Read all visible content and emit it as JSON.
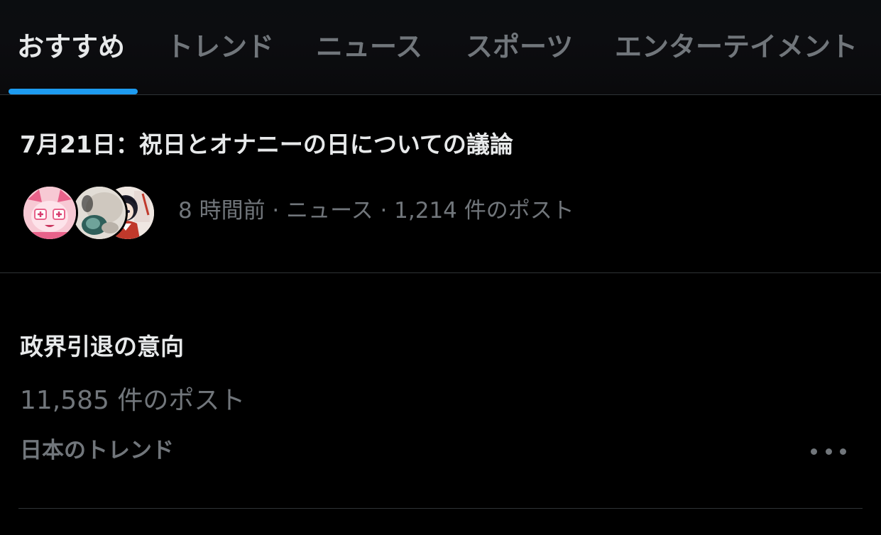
{
  "tabs": [
    {
      "label": "おすすめ",
      "active": true
    },
    {
      "label": "トレンド",
      "active": false
    },
    {
      "label": "ニュース",
      "active": false
    },
    {
      "label": "スポーツ",
      "active": false
    },
    {
      "label": "エンターテイメント",
      "active": false
    }
  ],
  "colors": {
    "background": "#000000",
    "primary_text": "#e7e9ea",
    "secondary_text": "#71767b",
    "accent": "#1d9bf0",
    "divider": "#2f3336"
  },
  "trends": [
    {
      "title": "7月21日：祝日とオナニーの日についての議論",
      "meta": "8 時間前 · ニュース · 1,214 件のポスト",
      "avatars": [
        "pink-anime-character-avatar",
        "photo-avatar",
        "anime-girl-painter-avatar"
      ]
    },
    {
      "title": "政界引退の意向",
      "post_count": "11,585 件のポスト",
      "context": "日本のトレンド",
      "more_icon": "more-horizontal-icon"
    }
  ]
}
